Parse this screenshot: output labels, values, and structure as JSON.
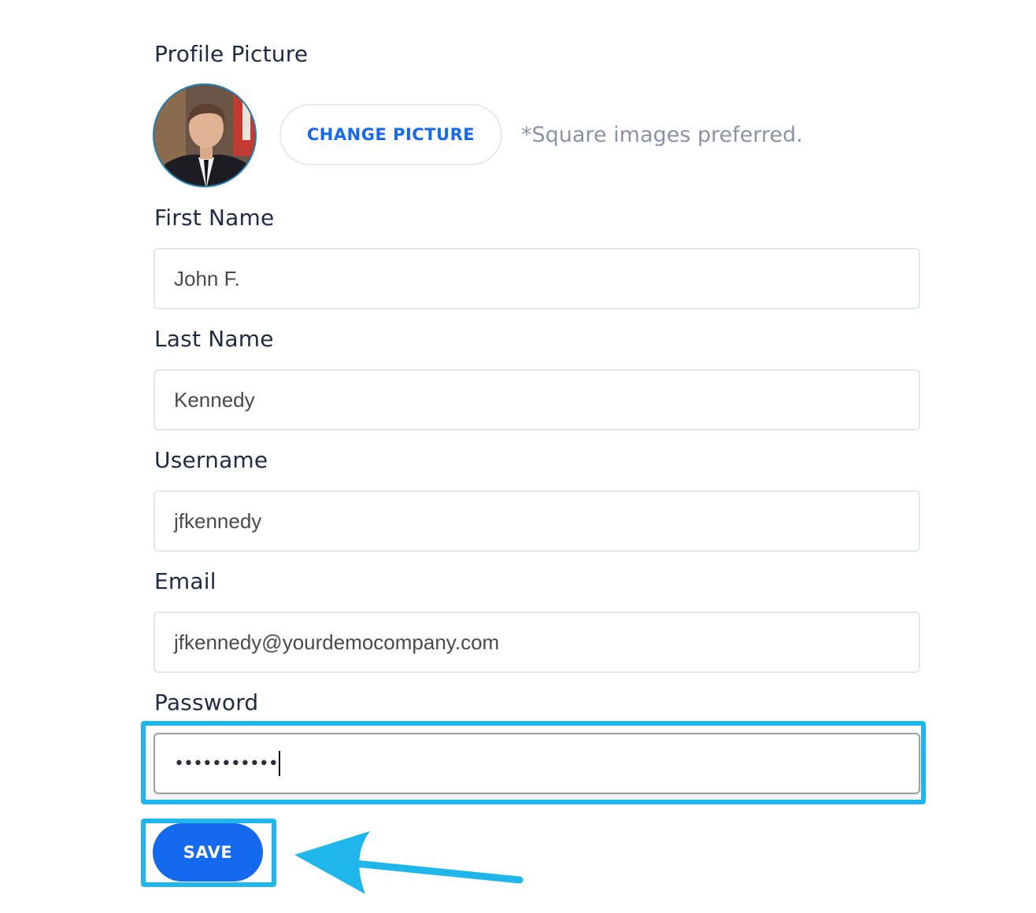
{
  "profile": {
    "picture_label": "Profile Picture",
    "change_picture_label": "CHANGE PICTURE",
    "hint": "*Square images preferred."
  },
  "form": {
    "first_name": {
      "label": "First Name",
      "value": "John F."
    },
    "last_name": {
      "label": "Last Name",
      "value": "Kennedy"
    },
    "username": {
      "label": "Username",
      "value": "jfkennedy"
    },
    "email": {
      "label": "Email",
      "value": "jfkennedy@yourdemocompany.com"
    },
    "password": {
      "label": "Password",
      "masked_value": "•••••••••••"
    }
  },
  "actions": {
    "save_label": "SAVE"
  },
  "colors": {
    "primary": "#1469ef",
    "highlight": "#1fb6ec",
    "text": "#1f2a44",
    "hint": "#8a93a6"
  },
  "icons": {
    "annotation": "arrow-left-icon"
  }
}
